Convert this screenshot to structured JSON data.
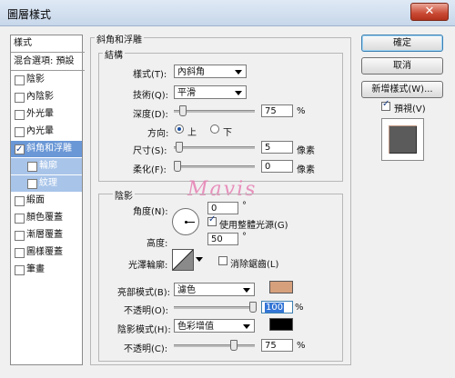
{
  "window": {
    "title": "圖層樣式",
    "close_label": "✕"
  },
  "sidebar": {
    "header": "樣式",
    "blend_options": "混合選項: 預設",
    "items": [
      {
        "label": "陰影",
        "checked": false
      },
      {
        "label": "內陰影",
        "checked": false
      },
      {
        "label": "外光暈",
        "checked": false
      },
      {
        "label": "內光暈",
        "checked": false
      },
      {
        "label": "斜角和浮雕",
        "checked": true,
        "selected": true
      },
      {
        "label": "輪廓",
        "checked": false,
        "sub": true
      },
      {
        "label": "紋理",
        "checked": false,
        "sub": true
      },
      {
        "label": "緞面",
        "checked": false
      },
      {
        "label": "顏色覆蓋",
        "checked": false
      },
      {
        "label": "漸層覆蓋",
        "checked": false
      },
      {
        "label": "圖樣覆蓋",
        "checked": false
      },
      {
        "label": "筆畫",
        "checked": false
      }
    ]
  },
  "panel": {
    "title": "斜角和浮雕",
    "structure": {
      "title": "結構",
      "style_label": "樣式(T):",
      "style_value": "內斜角",
      "technique_label": "技術(Q):",
      "technique_value": "平滑",
      "depth_label": "深度(D):",
      "depth_value": "75",
      "depth_unit": "%",
      "depth_level": 0.07,
      "direction_label": "方向:",
      "direction_up": "上",
      "direction_down": "下",
      "direction_selected": "上",
      "size_label": "尺寸(S):",
      "size_value": "5",
      "size_unit": "像素",
      "size_level": 0.02,
      "soften_label": "柔化(F):",
      "soften_value": "0",
      "soften_unit": "像素",
      "soften_level": 0.0
    },
    "shading": {
      "title": "陰影",
      "angle_label": "角度(N):",
      "angle_value": "0",
      "angle_unit": "°",
      "global_light_label": "使用整體光源(G)",
      "global_light_checked": true,
      "altitude_label": "高度:",
      "altitude_value": "50",
      "altitude_unit": "°",
      "gloss_contour_label": "光澤輪廓:",
      "anti_alias_label": "消除鋸齒(L)",
      "anti_alias_checked": false,
      "highlight_mode_label": "亮部模式(B):",
      "highlight_mode_value": "濾色",
      "highlight_color": "#d6a07c",
      "highlight_opacity_label": "不透明(O):",
      "highlight_opacity_value": "100",
      "highlight_opacity_unit": "%",
      "highlight_opacity_level": 1.0,
      "shadow_mode_label": "陰影模式(H):",
      "shadow_mode_value": "色彩增值",
      "shadow_color": "#000000",
      "shadow_opacity_label": "不透明(C):",
      "shadow_opacity_value": "75",
      "shadow_opacity_unit": "%",
      "shadow_opacity_level": 0.75
    }
  },
  "buttons": {
    "ok": "確定",
    "cancel": "取消",
    "new_style": "新增樣式(W)...",
    "preview_label": "預視(V)",
    "preview_checked": true
  },
  "watermark": "Mavis",
  "colors": {
    "selection": "#6a97d6",
    "sub_selection": "#a8c4e9",
    "accent_border": "#3c7fb1"
  }
}
